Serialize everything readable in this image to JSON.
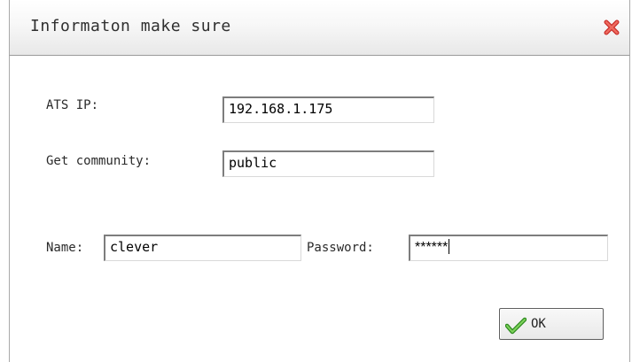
{
  "dialog": {
    "title": "Informaton make sure",
    "close_icon": "close-icon",
    "close_color": "#d9534f"
  },
  "form": {
    "ats_ip_label": "ATS IP:",
    "ats_ip_value": "192.168.1.175",
    "community_label": "Get community:",
    "community_value": "public",
    "name_label": "Name:",
    "name_value": "clever",
    "password_label": "Password:",
    "password_value": "******"
  },
  "actions": {
    "ok_label": "OK",
    "ok_icon": "checkmark-icon",
    "ok_icon_color": "#4cae2c"
  }
}
